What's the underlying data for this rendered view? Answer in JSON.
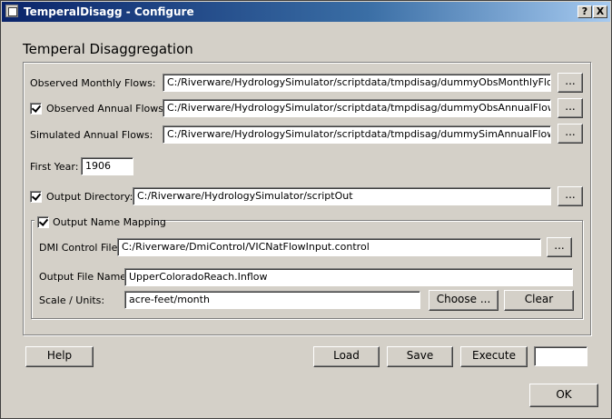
{
  "window": {
    "title": "TemperalDisagg - Configure",
    "help_glyph": "?",
    "close_glyph": "X"
  },
  "group_title": "Temperal Disaggregation",
  "observed_monthly": {
    "label": "Observed Monthly Flows:",
    "value": "C:/Riverware/HydrologySimulator/scriptdata/tmpdisag/dummyObsMonthlyFlows.txt",
    "browse_label": "..."
  },
  "observed_annual": {
    "label": "Observed Annual Flows:",
    "checked": true,
    "value": "C:/Riverware/HydrologySimulator/scriptdata/tmpdisag/dummyObsAnnualFlows.txt",
    "browse_label": "..."
  },
  "simulated_annual": {
    "label": "Simulated Annual Flows:",
    "value": "C:/Riverware/HydrologySimulator/scriptdata/tmpdisag/dummySimAnnualFlows.txt",
    "browse_label": "..."
  },
  "first_year": {
    "label": "First Year:",
    "value": "1906"
  },
  "output_directory": {
    "label": "Output Directory:",
    "checked": true,
    "value": "C:/Riverware/HydrologySimulator/scriptOut",
    "browse_label": "..."
  },
  "output_name_mapping": {
    "label": "Output Name Mapping",
    "checked": true,
    "dmi_label": "DMI Control File:",
    "dmi_value": "C:/Riverware/DmiControl/VICNatFlowInput.control",
    "dmi_browse_label": "...",
    "file_name_label": "Output File Name:",
    "file_name_value": "UpperColoradoReach.Inflow",
    "scale_label": "Scale / Units:",
    "scale_value": "acre-feet/month",
    "choose_label": "Choose ...",
    "clear_label": "Clear"
  },
  "buttons": {
    "help": "Help",
    "load": "Load",
    "save": "Save",
    "execute": "Execute",
    "ok": "OK"
  },
  "status_value": ""
}
